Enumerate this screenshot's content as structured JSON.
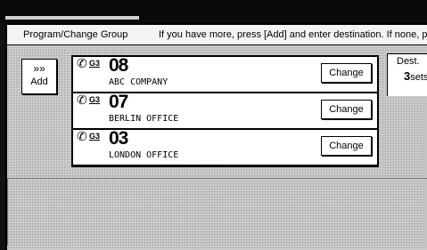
{
  "header": {
    "title": "Program/Change Group",
    "hint": "If you have more, press [Add] and enter destination. If none, p"
  },
  "add_button": {
    "chevron": "»»",
    "label": "Add"
  },
  "entries": [
    {
      "line": "G3",
      "number": "08",
      "name": "ABC COMPANY",
      "button_label": "Change"
    },
    {
      "line": "G3",
      "number": "07",
      "name": "BERLIN OFFICE",
      "button_label": "Change"
    },
    {
      "line": "G3",
      "number": "03",
      "name": "LONDON OFFICE",
      "button_label": "Change"
    }
  ],
  "dest": {
    "label": "Dest.",
    "count": "3",
    "unit": "sets"
  },
  "icons": {
    "phone": "phone-icon"
  }
}
